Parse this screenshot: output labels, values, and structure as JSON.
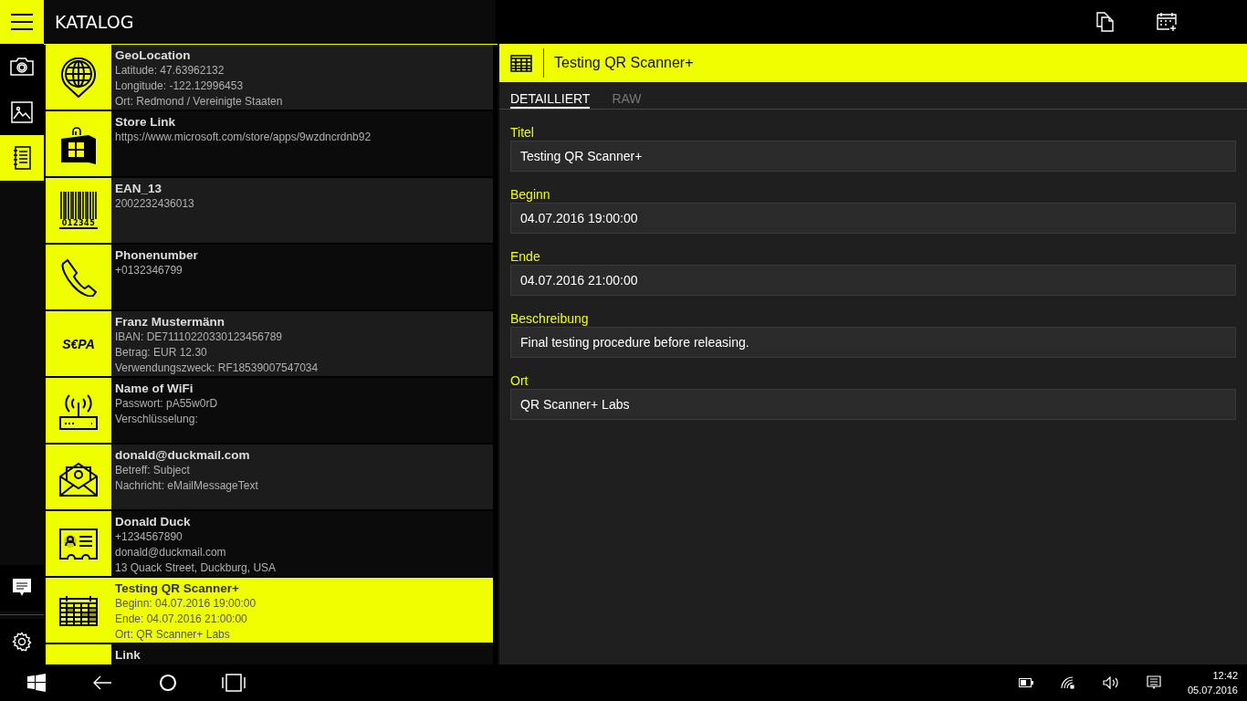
{
  "app_title": "KATALOG",
  "rail": [
    {
      "kind": "camera",
      "selected": false
    },
    {
      "kind": "image",
      "selected": false
    },
    {
      "kind": "catalog",
      "selected": true
    }
  ],
  "catalog": [
    {
      "kind": "geo",
      "selected": false,
      "title": "GeoLocation",
      "lines": [
        "Latitude: 47.63962132",
        "Longitude: -122.12996453",
        "Ort: Redmond / Vereinigte Staaten"
      ]
    },
    {
      "kind": "store",
      "selected": false,
      "title": "Store Link",
      "lines": [
        "https://www.microsoft.com/store/apps/9wzdncrdnb92"
      ]
    },
    {
      "kind": "barcode",
      "selected": false,
      "icon_text": "012345",
      "title": "EAN_13",
      "lines": [
        "2002232436013"
      ]
    },
    {
      "kind": "phone",
      "selected": false,
      "title": "Phonenumber",
      "lines": [
        "+0132346799"
      ]
    },
    {
      "kind": "sepa",
      "selected": false,
      "icon_text": "S€PA",
      "title": "Franz Mustermänn",
      "lines": [
        "IBAN: DE71110220330123456789",
        "Betrag: EUR 12.30",
        "Verwendungszweck: RF18539007547034"
      ]
    },
    {
      "kind": "wifi",
      "selected": false,
      "title": "Name of WiFi",
      "lines": [
        "Passwort: pA55w0rD",
        "Verschlüsselung:"
      ]
    },
    {
      "kind": "email",
      "selected": false,
      "title": "donald@duckmail.com",
      "lines": [
        "Betreff: Subject",
        "Nachricht: eMailMessageText"
      ]
    },
    {
      "kind": "contact",
      "selected": false,
      "title": "Donald Duck",
      "lines": [
        "+1234567890",
        "donald@duckmail.com",
        "13 Quack Street, Duckburg, USA"
      ]
    },
    {
      "kind": "calendar",
      "selected": true,
      "title": "Testing QR Scanner+",
      "lines": [
        "Beginn: 04.07.2016 19:00:00",
        "Ende: 04.07.2016 21:00:00",
        "Ort: QR Scanner+ Labs"
      ]
    },
    {
      "kind": "link",
      "selected": false,
      "title": "Link"
    }
  ],
  "detail": {
    "title": "Testing QR Scanner+",
    "tabs": [
      {
        "label": "DETAILLIERT",
        "selected": true
      },
      {
        "label": "RAW",
        "selected": false
      }
    ],
    "fields": [
      {
        "label": "Titel",
        "value": "Testing QR Scanner+"
      },
      {
        "label": "Beginn",
        "value": "04.07.2016 19:00:00"
      },
      {
        "label": "Ende",
        "value": "04.07.2016 21:00:00"
      },
      {
        "label": "Beschreibung",
        "value": "Final testing procedure before releasing."
      },
      {
        "label": "Ort",
        "value": "QR Scanner+ Labs"
      }
    ]
  },
  "taskbar": {
    "time": "12:42",
    "date": "05.07.2016"
  }
}
